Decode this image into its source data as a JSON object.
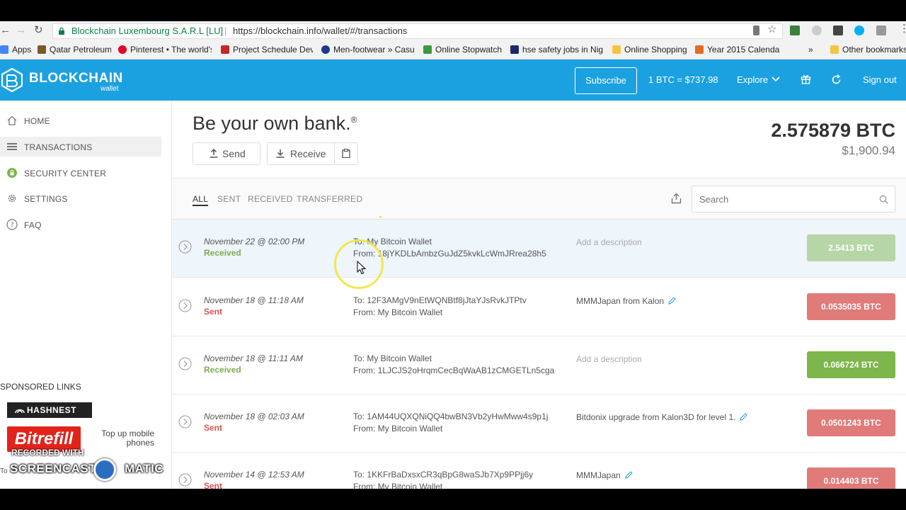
{
  "browser": {
    "site_name": "Blockchain Luxembourg S.A.R.L [LU]",
    "url_separator": "|",
    "url": "https://blockchain.info/wallet/#/transactions",
    "bookmarks": [
      {
        "label": "Apps",
        "color": "#4285f4"
      },
      {
        "label": "Qatar Petroleum",
        "color": "#7b5a2e"
      },
      {
        "label": "Pinterest • The world's",
        "color": "#e60023"
      },
      {
        "label": "Project Schedule Dev",
        "color": "#c62828"
      },
      {
        "label": "Men-footwear » Casu",
        "color": "#1a3a8a"
      },
      {
        "label": "Online Stopwatch",
        "color": "#3c9a3c"
      },
      {
        "label": "hse safety jobs in Nig",
        "color": "#1b2a6b"
      },
      {
        "label": "Online Shopping",
        "color": "#f4c542"
      },
      {
        "label": "Year 2015 Calendar",
        "color": "#e56b1f"
      }
    ],
    "more_bookmarks": "»",
    "other_bookmarks": "Other bookmarks"
  },
  "header": {
    "logo_text": "BLOCKCHAIN",
    "logo_sub": "wallet",
    "subscribe": "Subscribe",
    "btc_rate": "1 BTC =  $737.98",
    "explore": "Explore",
    "sign_out": "Sign out",
    "brand_color": "#1ca1e0"
  },
  "sidebar": {
    "items": [
      {
        "label": "HOME",
        "icon": "home-icon"
      },
      {
        "label": "TRANSACTIONS",
        "icon": "list-icon"
      },
      {
        "label": "SECURITY CENTER",
        "icon": "lock-icon"
      },
      {
        "label": "SETTINGS",
        "icon": "gear-icon"
      },
      {
        "label": "FAQ",
        "icon": "question-icon"
      }
    ],
    "sponsored_title": "SPONSORED LINKS",
    "hashnest": "HASHNEST",
    "bitrefill": "Bitrefill",
    "topup": "Top up mobile phones",
    "to_text": "To",
    "watermark_top": "RECORDED WITH",
    "watermark_main": "SCREENCAST",
    "watermark_tail": "MATIC"
  },
  "hero": {
    "tagline": "Be your own bank.",
    "reg": "®",
    "send": "Send",
    "receive": "Receive",
    "balance_btc": "2.575879 BTC",
    "balance_fiat": "$1,900.94"
  },
  "filters": {
    "tabs": [
      "ALL",
      "SENT",
      "RECEIVED",
      "TRANSFERRED"
    ],
    "search_placeholder": "Search"
  },
  "transactions": [
    {
      "date": "November 22 @ 02:00 PM",
      "type": "Received",
      "to": "To: My Bitcoin Wallet",
      "from": "From: 18jYKDLbAmbzGuJdZ5kvkLcWmJRrea28h5",
      "desc": "Add a description",
      "amount": "2.5413 BTC"
    },
    {
      "date": "November 18 @ 11:18 AM",
      "type": "Sent",
      "to": "To: 12F3AMgV9nEtWQNBtf8jJtaYJsRvkJTPtv",
      "from": "From: My Bitcoin Wallet",
      "desc": "MMMJapan from Kalon",
      "amount": "0.0535035 BTC"
    },
    {
      "date": "November 18 @ 11:11 AM",
      "type": "Received",
      "to": "To: My Bitcoin Wallet",
      "from": "From: 1LJCJS2oHrqmCecBqWaAB1zCMGETLn5cga",
      "desc": "Add a description",
      "amount": "0.066724 BTC"
    },
    {
      "date": "November 18 @ 02:03 AM",
      "type": "Sent",
      "to": "To: 1AM44UQXQNiQQ4bwBN3Vb2yHwMww4s9p1j",
      "from": "From: My Bitcoin Wallet",
      "desc": "Bitdonix upgrade from Kalon3D for level 1.",
      "amount": "0.0501243 BTC"
    },
    {
      "date": "November 14 @ 12:53 AM",
      "type": "Sent",
      "to": "To: 1KKFrBaDxsxCR3qBpG8waSJb7Xp9PPjj6y",
      "from": "From: My Bitcoin Wallet",
      "desc": "MMMJapan",
      "amount": "0.014403 BTC"
    }
  ]
}
